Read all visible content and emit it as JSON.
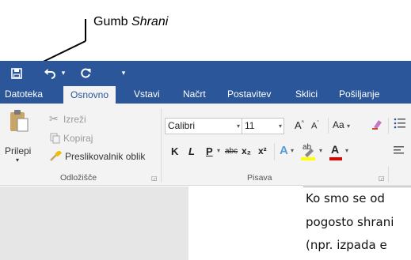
{
  "annotation": {
    "label": "Gumb ",
    "label_italic": "Shrani"
  },
  "quick_access": {
    "icons": [
      "save-icon",
      "undo-icon",
      "undo-dropdown-icon",
      "redo-icon",
      "customize-dropdown-icon"
    ]
  },
  "tabs": [
    "Datoteka",
    "Osnovno",
    "Vstavi",
    "Načrt",
    "Postavitev",
    "Sklici",
    "Pošiljanje"
  ],
  "clipboard": {
    "paste_label": "Prilepi",
    "cut_label": "Izreži",
    "copy_label": "Kopiraj",
    "format_painter_label": "Preslikovalnik oblik",
    "group_label": "Odložišče"
  },
  "font": {
    "font_name": "Calibri",
    "font_size": "11",
    "bold": "K",
    "italic": "L",
    "underline": "P",
    "strikethrough": "abc",
    "subscript": "x₂",
    "superscript": "x²",
    "change_case": "Aa",
    "grow_font": "A",
    "shrink_font": "A",
    "text_effects": "A",
    "highlight": "ab",
    "font_color": "A",
    "group_label": "Pisava"
  },
  "document": {
    "lines": [
      "Ko smo se od",
      "pogosto shrani",
      "(npr. izpada e"
    ]
  },
  "colors": {
    "ribbon_blue": "#2b579a",
    "ribbon_bg": "#f3f3f3",
    "highlight_yellow": "#ffff00",
    "font_color_red": "#e00000"
  }
}
